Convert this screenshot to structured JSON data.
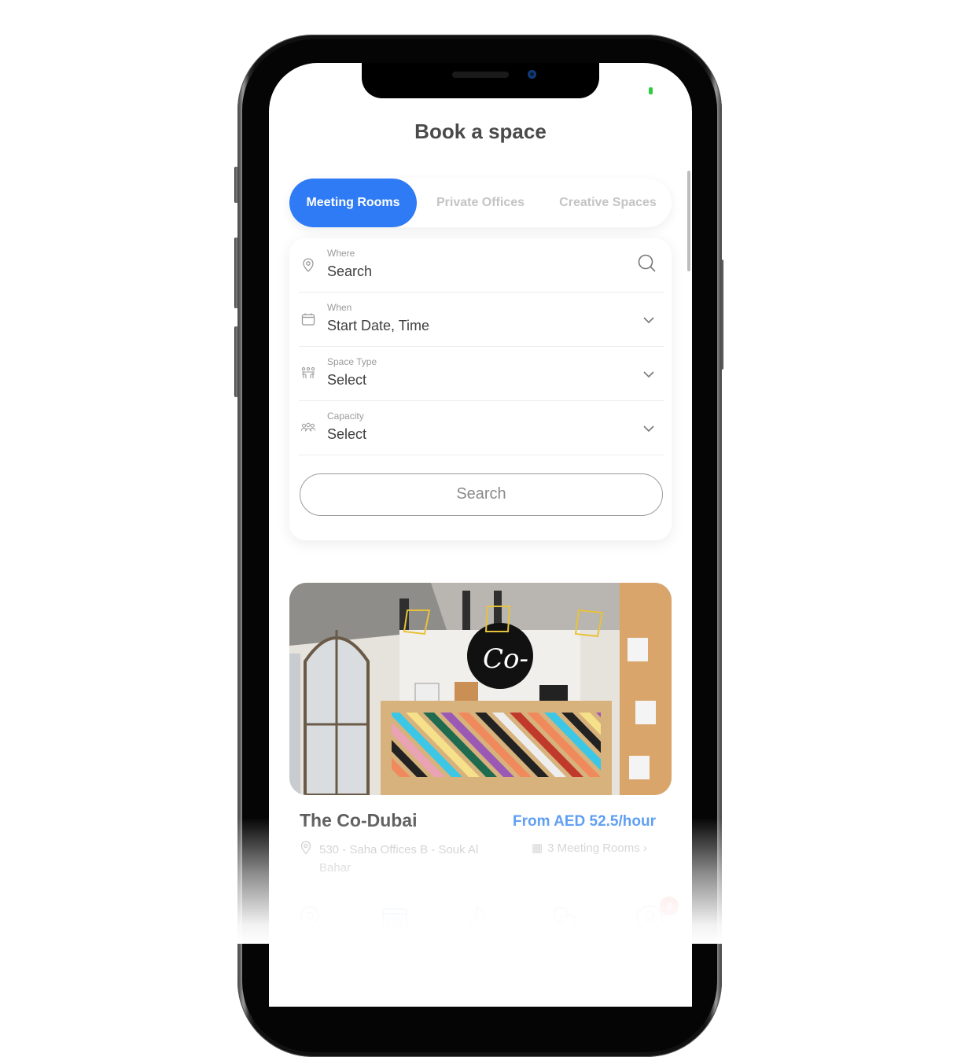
{
  "header": {
    "title": "Book a space"
  },
  "tabs": [
    {
      "label": "Meeting Rooms",
      "active": true
    },
    {
      "label": "Private Offices",
      "active": false
    },
    {
      "label": "Creative Spaces",
      "active": false
    }
  ],
  "form": {
    "fields": [
      {
        "label": "Where",
        "value": "Search",
        "icon": "location-pin-icon",
        "action_icon": "search-icon"
      },
      {
        "label": "When",
        "value": "Start Date, Time",
        "icon": "calendar-icon",
        "action_icon": "chevron-down-icon"
      },
      {
        "label": "Space Type",
        "value": "Select",
        "icon": "meeting-table-icon",
        "action_icon": "chevron-down-icon"
      },
      {
        "label": "Capacity",
        "value": "Select",
        "icon": "people-group-icon",
        "action_icon": "chevron-down-icon"
      }
    ],
    "search_button": "Search"
  },
  "listing": {
    "name": "The Co-Dubai",
    "price": "From AED 52.5/hour",
    "address": "530 - Saha Offices B - Souk Al Bahar",
    "rooms_link": "3 Meeting Rooms",
    "logo_text": "Co-"
  },
  "bottom_nav": {
    "items": [
      "location-icon",
      "calendar-icon",
      "spaces-icon",
      "chat-icon",
      "profile-icon"
    ],
    "active_index": 1,
    "badge_count": "4"
  },
  "colors": {
    "accent": "#2f7bf5",
    "price": "#5a9cf2",
    "status_green": "#2ecc40",
    "badge": "#f8c8c8"
  }
}
